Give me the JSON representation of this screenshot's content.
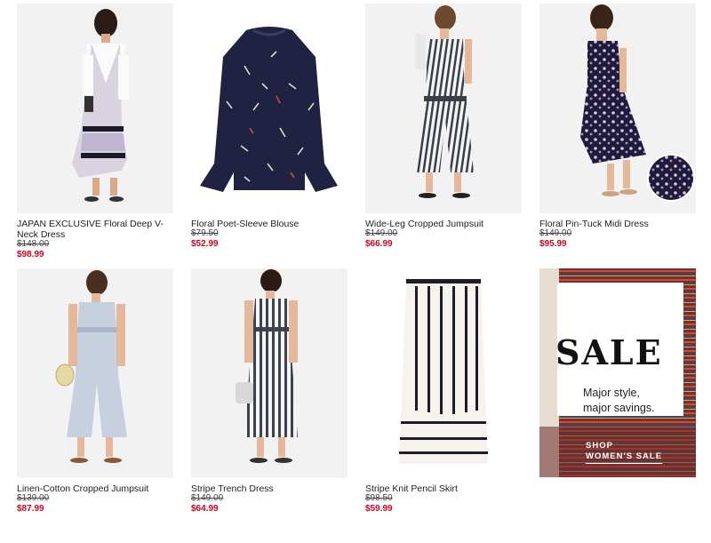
{
  "products": [
    {
      "name": "JAPAN EXCLUSIVE Floral Deep V-Neck Dress",
      "was": "$148.00",
      "now": "$98.99",
      "image": "floral-vneck-dress-photo"
    },
    {
      "name": "Floral Poet-Sleeve Blouse",
      "was": "$79.50",
      "now": "$52.99",
      "image": "poet-sleeve-blouse-photo"
    },
    {
      "name": "Wide-Leg Cropped Jumpsuit",
      "was": "$149.00",
      "now": "$66.99",
      "image": "striped-jumpsuit-photo"
    },
    {
      "name": "Floral Pin-Tuck Midi Dress",
      "was": "$149.00",
      "now": "$95.99",
      "image": "floral-midi-dress-photo"
    },
    {
      "name": "Linen-Cotton Cropped Jumpsuit",
      "was": "$139.00",
      "now": "$87.99",
      "image": "linen-jumpsuit-photo"
    },
    {
      "name": "Stripe Trench Dress",
      "was": "$149.00",
      "now": "$64.99",
      "image": "stripe-trench-dress-photo"
    },
    {
      "name": "Stripe Knit Pencil Skirt",
      "was": "$98.50",
      "now": "$59.99",
      "image": "stripe-pencil-skirt-photo"
    }
  ],
  "promo": {
    "title": "SALE",
    "subtitle_line1": "Major style,",
    "subtitle_line2": "major savings.",
    "cta_line1": "SHOP",
    "cta_line2": "WOMEN'S SALE"
  },
  "colors": {
    "sale_price": "#d0021b",
    "text": "#222222",
    "image_bg": "#f1f1f1"
  }
}
